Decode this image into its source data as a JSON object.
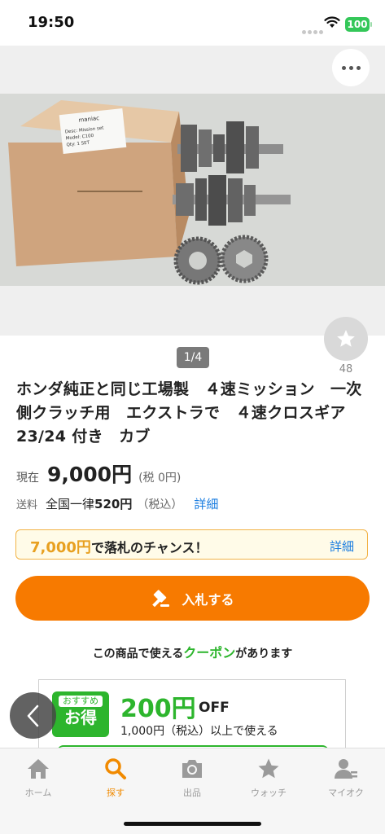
{
  "status_bar": {
    "time": "19:50",
    "battery": "100"
  },
  "image": {
    "box_label_brand": "maniac",
    "box_label_desc": "Desc: Mission set",
    "box_label_model": "Model: C100",
    "box_label_qty": "Qty: 1 SET",
    "page_indicator": "1/4"
  },
  "watch": {
    "count": "48"
  },
  "item": {
    "title": "ホンダ純正と同じ工場製　４速ミッション　一次側クラッチ用　エクストラで　４速クロスギア 23/24 付き　カブ",
    "price_label": "現在",
    "price": "9,000円",
    "price_tax": "(税 0円)",
    "shipping_label": "送料",
    "shipping_prefix": "全国一律",
    "shipping_price": "520円",
    "shipping_tax": "（税込）",
    "detail_link": "詳細"
  },
  "chance": {
    "price": "7,000円",
    "text": "で落札のチャンス！",
    "detail": "詳細"
  },
  "bid_button": {
    "label": "入札する"
  },
  "coupon": {
    "line_prefix": "この商品で使える",
    "line_highlight": "クーポン",
    "line_suffix": "があります",
    "badge_top": "おすすめ",
    "badge_main": "お得",
    "amount": "200円",
    "off": "OFF",
    "condition": "1,000円（税込）以上で使える"
  },
  "tabs": [
    {
      "label": "ホーム",
      "icon": "home-icon"
    },
    {
      "label": "探す",
      "icon": "search-icon"
    },
    {
      "label": "出品",
      "icon": "camera-icon"
    },
    {
      "label": "ウォッチ",
      "icon": "star-icon"
    },
    {
      "label": "マイオク",
      "icon": "user-icon"
    }
  ],
  "colors": {
    "accent": "#f77a00",
    "link": "#1a7de0",
    "coupon_green": "#2db52d",
    "active_tab": "#f18a00"
  }
}
